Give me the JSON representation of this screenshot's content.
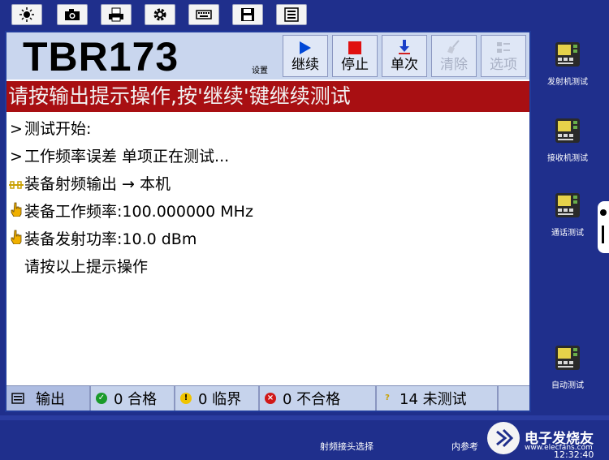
{
  "toolbar": {
    "icons": [
      "brightness-icon",
      "camera-icon",
      "printer-icon",
      "gear-icon",
      "keyboard-icon",
      "save-icon",
      "document-icon"
    ]
  },
  "header": {
    "model": "TBR173",
    "settings_label": "设置",
    "buttons": [
      {
        "label": "继续",
        "icon": "play-icon",
        "enabled": true
      },
      {
        "label": "停止",
        "icon": "stop-icon",
        "enabled": true
      },
      {
        "label": "单次",
        "icon": "single-step-icon",
        "enabled": true
      },
      {
        "label": "清除",
        "icon": "broom-icon",
        "enabled": false
      },
      {
        "label": "选项",
        "icon": "options-icon",
        "enabled": false
      }
    ]
  },
  "banner": "请按输出提示操作,按'继续'键继续测试",
  "log": [
    {
      "prefix": ">",
      "text": "测试开始:"
    },
    {
      "prefix": ">",
      "text": "工作频率误差 单项正在测试..."
    },
    {
      "prefix": "",
      "text": "装备射频输出 → 本机"
    },
    {
      "prefix": "",
      "text": "装备工作频率:100.000000 MHz"
    },
    {
      "prefix": "",
      "text": "装备发射功率:10.0 dBm"
    },
    {
      "prefix": "",
      "text": "请按以上提示操作"
    }
  ],
  "status": {
    "output": "输出",
    "pass": "0 合格",
    "marginal": "0 临界",
    "fail": "0 不合格",
    "untested": "14 未测试"
  },
  "sidebar": [
    {
      "label": "发射机测试"
    },
    {
      "label": "接收机测试"
    },
    {
      "label": "通话测试"
    },
    {
      "label": "自动测试"
    }
  ],
  "footer": {
    "rf_select": "射频接头选择",
    "ref": "内参考",
    "time": "12:32:40",
    "watermark": "电子发烧友",
    "watermark_url": "www.elecfans.com"
  },
  "colors": {
    "banner": "#a80f12",
    "background": "#1f2f8c",
    "header": "#c9d6ee"
  }
}
